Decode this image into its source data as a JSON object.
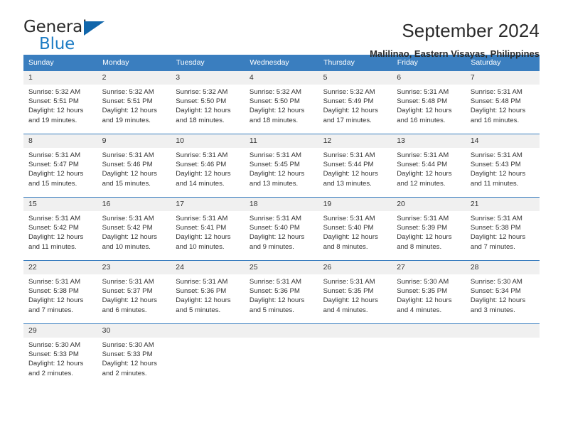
{
  "logo": {
    "word1": "General",
    "word2": "Blue",
    "triangle_color": "#1166ab",
    "blue_color": "#1d7cc4"
  },
  "header": {
    "month_title": "September 2024",
    "location": "Malilinao, Eastern Visayas, Philippines"
  },
  "theme": {
    "header_blue": "#3a7ebf",
    "daynum_bg": "#f0f0f0",
    "text": "#333333"
  },
  "weekdays": [
    "Sunday",
    "Monday",
    "Tuesday",
    "Wednesday",
    "Thursday",
    "Friday",
    "Saturday"
  ],
  "weeks": [
    [
      {
        "day": "1",
        "lines": [
          "Sunrise: 5:32 AM",
          "Sunset: 5:51 PM",
          "Daylight: 12 hours",
          "and 19 minutes."
        ]
      },
      {
        "day": "2",
        "lines": [
          "Sunrise: 5:32 AM",
          "Sunset: 5:51 PM",
          "Daylight: 12 hours",
          "and 19 minutes."
        ]
      },
      {
        "day": "3",
        "lines": [
          "Sunrise: 5:32 AM",
          "Sunset: 5:50 PM",
          "Daylight: 12 hours",
          "and 18 minutes."
        ]
      },
      {
        "day": "4",
        "lines": [
          "Sunrise: 5:32 AM",
          "Sunset: 5:50 PM",
          "Daylight: 12 hours",
          "and 18 minutes."
        ]
      },
      {
        "day": "5",
        "lines": [
          "Sunrise: 5:32 AM",
          "Sunset: 5:49 PM",
          "Daylight: 12 hours",
          "and 17 minutes."
        ]
      },
      {
        "day": "6",
        "lines": [
          "Sunrise: 5:31 AM",
          "Sunset: 5:48 PM",
          "Daylight: 12 hours",
          "and 16 minutes."
        ]
      },
      {
        "day": "7",
        "lines": [
          "Sunrise: 5:31 AM",
          "Sunset: 5:48 PM",
          "Daylight: 12 hours",
          "and 16 minutes."
        ]
      }
    ],
    [
      {
        "day": "8",
        "lines": [
          "Sunrise: 5:31 AM",
          "Sunset: 5:47 PM",
          "Daylight: 12 hours",
          "and 15 minutes."
        ]
      },
      {
        "day": "9",
        "lines": [
          "Sunrise: 5:31 AM",
          "Sunset: 5:46 PM",
          "Daylight: 12 hours",
          "and 15 minutes."
        ]
      },
      {
        "day": "10",
        "lines": [
          "Sunrise: 5:31 AM",
          "Sunset: 5:46 PM",
          "Daylight: 12 hours",
          "and 14 minutes."
        ]
      },
      {
        "day": "11",
        "lines": [
          "Sunrise: 5:31 AM",
          "Sunset: 5:45 PM",
          "Daylight: 12 hours",
          "and 13 minutes."
        ]
      },
      {
        "day": "12",
        "lines": [
          "Sunrise: 5:31 AM",
          "Sunset: 5:44 PM",
          "Daylight: 12 hours",
          "and 13 minutes."
        ]
      },
      {
        "day": "13",
        "lines": [
          "Sunrise: 5:31 AM",
          "Sunset: 5:44 PM",
          "Daylight: 12 hours",
          "and 12 minutes."
        ]
      },
      {
        "day": "14",
        "lines": [
          "Sunrise: 5:31 AM",
          "Sunset: 5:43 PM",
          "Daylight: 12 hours",
          "and 11 minutes."
        ]
      }
    ],
    [
      {
        "day": "15",
        "lines": [
          "Sunrise: 5:31 AM",
          "Sunset: 5:42 PM",
          "Daylight: 12 hours",
          "and 11 minutes."
        ]
      },
      {
        "day": "16",
        "lines": [
          "Sunrise: 5:31 AM",
          "Sunset: 5:42 PM",
          "Daylight: 12 hours",
          "and 10 minutes."
        ]
      },
      {
        "day": "17",
        "lines": [
          "Sunrise: 5:31 AM",
          "Sunset: 5:41 PM",
          "Daylight: 12 hours",
          "and 10 minutes."
        ]
      },
      {
        "day": "18",
        "lines": [
          "Sunrise: 5:31 AM",
          "Sunset: 5:40 PM",
          "Daylight: 12 hours",
          "and 9 minutes."
        ]
      },
      {
        "day": "19",
        "lines": [
          "Sunrise: 5:31 AM",
          "Sunset: 5:40 PM",
          "Daylight: 12 hours",
          "and 8 minutes."
        ]
      },
      {
        "day": "20",
        "lines": [
          "Sunrise: 5:31 AM",
          "Sunset: 5:39 PM",
          "Daylight: 12 hours",
          "and 8 minutes."
        ]
      },
      {
        "day": "21",
        "lines": [
          "Sunrise: 5:31 AM",
          "Sunset: 5:38 PM",
          "Daylight: 12 hours",
          "and 7 minutes."
        ]
      }
    ],
    [
      {
        "day": "22",
        "lines": [
          "Sunrise: 5:31 AM",
          "Sunset: 5:38 PM",
          "Daylight: 12 hours",
          "and 7 minutes."
        ]
      },
      {
        "day": "23",
        "lines": [
          "Sunrise: 5:31 AM",
          "Sunset: 5:37 PM",
          "Daylight: 12 hours",
          "and 6 minutes."
        ]
      },
      {
        "day": "24",
        "lines": [
          "Sunrise: 5:31 AM",
          "Sunset: 5:36 PM",
          "Daylight: 12 hours",
          "and 5 minutes."
        ]
      },
      {
        "day": "25",
        "lines": [
          "Sunrise: 5:31 AM",
          "Sunset: 5:36 PM",
          "Daylight: 12 hours",
          "and 5 minutes."
        ]
      },
      {
        "day": "26",
        "lines": [
          "Sunrise: 5:31 AM",
          "Sunset: 5:35 PM",
          "Daylight: 12 hours",
          "and 4 minutes."
        ]
      },
      {
        "day": "27",
        "lines": [
          "Sunrise: 5:30 AM",
          "Sunset: 5:35 PM",
          "Daylight: 12 hours",
          "and 4 minutes."
        ]
      },
      {
        "day": "28",
        "lines": [
          "Sunrise: 5:30 AM",
          "Sunset: 5:34 PM",
          "Daylight: 12 hours",
          "and 3 minutes."
        ]
      }
    ],
    [
      {
        "day": "29",
        "lines": [
          "Sunrise: 5:30 AM",
          "Sunset: 5:33 PM",
          "Daylight: 12 hours",
          "and 2 minutes."
        ]
      },
      {
        "day": "30",
        "lines": [
          "Sunrise: 5:30 AM",
          "Sunset: 5:33 PM",
          "Daylight: 12 hours",
          "and 2 minutes."
        ]
      },
      {
        "day": "",
        "lines": []
      },
      {
        "day": "",
        "lines": []
      },
      {
        "day": "",
        "lines": []
      },
      {
        "day": "",
        "lines": []
      },
      {
        "day": "",
        "lines": []
      }
    ]
  ]
}
